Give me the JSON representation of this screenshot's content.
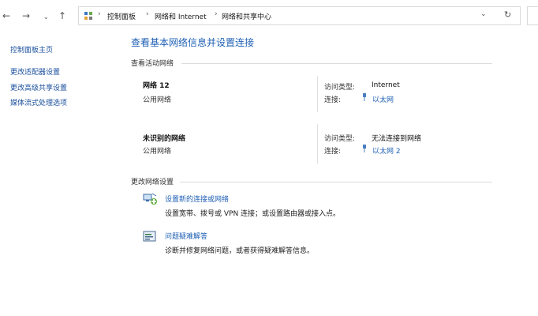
{
  "nav": {
    "back_icon": "back-arrow-icon",
    "forward_icon": "forward-arrow-icon",
    "history_icon": "chevron-down-icon",
    "up_icon": "up-arrow-icon"
  },
  "address": {
    "crumbs": [
      "控制面板",
      "网络和 Internet",
      "网络和共享中心"
    ],
    "dropdown_icon": "chevron-down-icon",
    "refresh_icon": "refresh-icon"
  },
  "sidebar": {
    "items": [
      {
        "label": "控制面板主页"
      },
      {
        "label": "更改适配器设置"
      },
      {
        "label": "更改高级共享设置"
      },
      {
        "label": "媒体流式处理选项"
      }
    ]
  },
  "main": {
    "title": "查看基本网络信息并设置连接",
    "active_networks_title": "查看活动网络",
    "networks": [
      {
        "name": "网络 12",
        "type": "公用网络",
        "access_label": "访问类型:",
        "access_value": "Internet",
        "conn_label": "连接:",
        "conn_value": "以太网"
      },
      {
        "name": "未识别的网络",
        "type": "公用网络",
        "access_label": "访问类型:",
        "access_value": "无法连接到网络",
        "conn_label": "连接:",
        "conn_value": "以太网 2"
      }
    ],
    "change_settings_title": "更改网络设置",
    "tasks": [
      {
        "link": "设置新的连接或网络",
        "desc": "设置宽带、拨号或 VPN 连接；或设置路由器或接入点。",
        "icon": "network-setup-icon"
      },
      {
        "link": "问题疑难解答",
        "desc": "诊断并修复网络问题，或者获得疑难解答信息。",
        "icon": "troubleshoot-icon"
      }
    ]
  }
}
